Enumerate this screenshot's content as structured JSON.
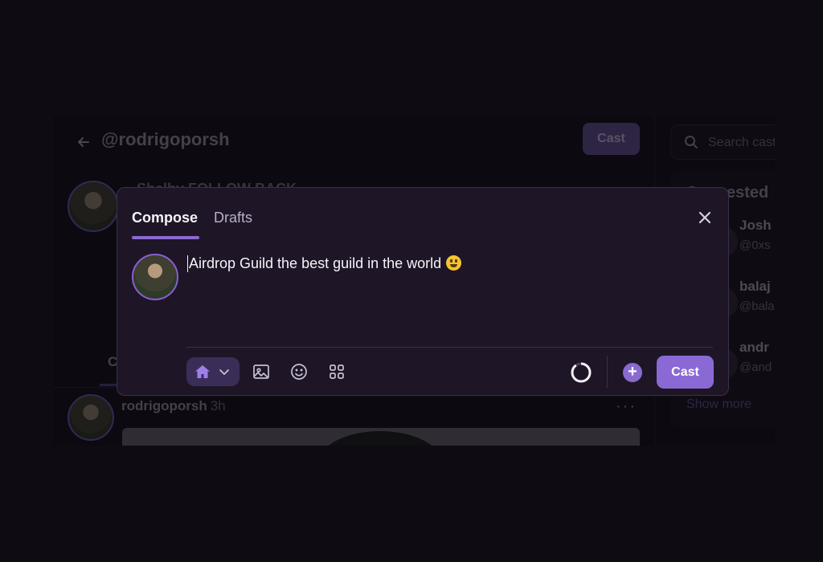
{
  "profile": {
    "handle": "@rodrigoporsh",
    "cast_label": "Cast",
    "display_name": "Shelby FOLLOW BACK",
    "tab_initial": "C"
  },
  "post": {
    "author": "rodrigoporsh",
    "time": "3h",
    "more": "···"
  },
  "sidebar": {
    "search_placeholder": "Search casts",
    "suggested_title": "Suggested",
    "users": [
      {
        "name": "Josh",
        "handle": "@0xs"
      },
      {
        "name": "balaj",
        "handle": "@bala"
      },
      {
        "name": "andr",
        "handle": "@and"
      }
    ],
    "show_more": "Show more"
  },
  "compose": {
    "tab_compose": "Compose",
    "tab_drafts": "Drafts",
    "text": "Airdrop Guild the best guild in the world",
    "cast_label": "Cast",
    "plus": "+"
  },
  "colors": {
    "accent": "#8b69d4",
    "modal_bg": "#1e1627",
    "page_bg": "#0e0b12"
  },
  "icons": [
    "back-arrow-icon",
    "search-icon",
    "close-icon",
    "home-icon",
    "chevron-down-icon",
    "image-icon",
    "emoji-icon",
    "apps-icon",
    "progress-ring-icon",
    "plus-icon"
  ]
}
